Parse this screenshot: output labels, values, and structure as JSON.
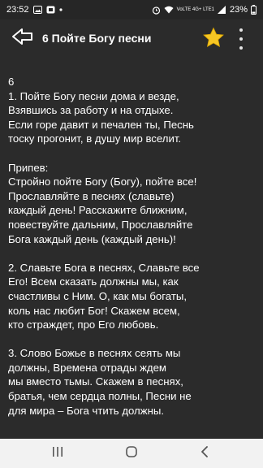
{
  "status": {
    "time": "23:52",
    "network": "VoLTE 4G+ LTE1",
    "battery": "23%"
  },
  "appbar": {
    "title": "6 Пойте Богу песни",
    "back_icon": "back-arrow-icon",
    "favorite_icon": "star-icon",
    "menu_icon": "more-vertical-icon",
    "star_color": "#f6c624"
  },
  "song": {
    "text": "6\n1. Пойте Богу песни дома и везде,\nВзявшись за работу и на отдыхе.\nЕсли горе давит и печален ты, Песнь\nтоску прогонит, в душу мир вселит.\n\nПрипев:\nСтройно пойте Богу (Богу), пойте все!\nПрославляйте в песнях (славьте)\nкаждый день! Расскажите ближним,\nповествуйте дальним, Прославляйте\nБога каждый день (каждый день)!\n\n2. Славьте Бога в песнях, Славьте все\nЕго! Всем сказать должны мы, как\nсчастливы с Ним. О, как мы богаты,\nколь нас любит Бог! Скажем всем,\nкто страждет, про Его любовь.\n\n3. Слово Божье в песнях сеять мы\nдолжны, Времена отрады ждем\nмы вместо тьмы. Скажем в песнях,\nбратья, чем сердца полны, Песни не\nдля мира – Бога чтить должны."
  },
  "navbar": {
    "recents_icon": "recents-icon",
    "home_icon": "home-icon",
    "back_icon": "nav-back-icon"
  }
}
